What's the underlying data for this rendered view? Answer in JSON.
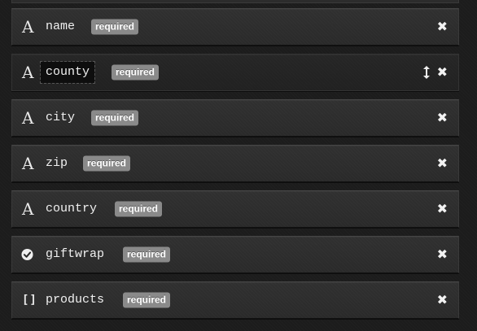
{
  "fields": [
    {
      "icon": "text-type-icon",
      "glyph": "A",
      "name": "name",
      "badge": "required"
    },
    {
      "icon": "text-type-icon",
      "glyph": "A",
      "name": "county",
      "badge": "required",
      "editing": true
    },
    {
      "icon": "text-type-icon",
      "glyph": "A",
      "name": "city",
      "badge": "required"
    },
    {
      "icon": "text-type-icon",
      "glyph": "A",
      "name": "zip",
      "badge": "required"
    },
    {
      "icon": "text-type-icon",
      "glyph": "A",
      "name": "country",
      "badge": "required"
    },
    {
      "icon": "boolean-check-icon",
      "glyph": "",
      "name": "giftwrap",
      "badge": "required"
    },
    {
      "icon": "array-brackets-icon",
      "glyph": "[]",
      "name": "products",
      "badge": "required"
    }
  ],
  "actions": {
    "remove_glyph": "✖",
    "move_icon": "vertical-resize-icon"
  },
  "colors": {
    "badge": "#8a8a8a",
    "row_background": "#2d2d2d",
    "text": "#f0f0f0"
  }
}
